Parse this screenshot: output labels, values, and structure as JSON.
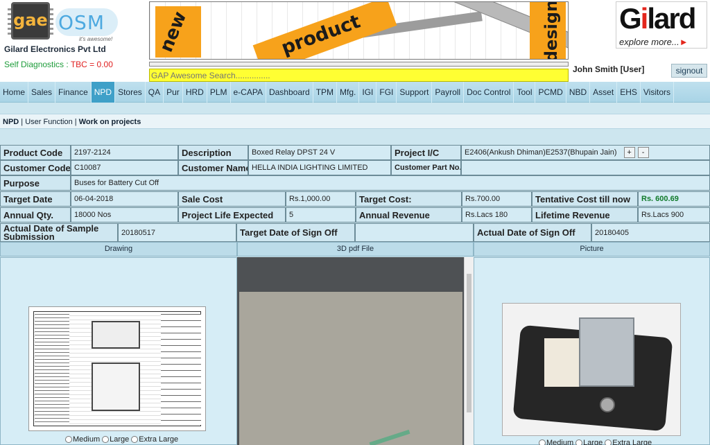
{
  "header": {
    "logo_gae": "gae",
    "logo_osm": "OSM",
    "logo_osm_tagline": "it's awesome!",
    "company": "Gilard Electronics Pvt Ltd",
    "self_diag_label": "Self Diagnostics :",
    "self_diag_value": "TBC = 0.00",
    "banner": {
      "w1": "new",
      "w2": "product",
      "w3": "design"
    },
    "search_placeholder": "GAP Awesome Search...............",
    "brand_logo": "Gilard",
    "brand_tagline": "explore more...",
    "user": "John Smith [User]",
    "signout": "signout"
  },
  "nav": [
    "Home",
    "Sales",
    "Finance",
    "NPD",
    "Stores",
    "QA",
    "Pur",
    "HRD",
    "PLM",
    "e-CAPA",
    "Dashboard",
    "TPM",
    "Mfg.",
    "IGI",
    "FGI",
    "Support",
    "Payroll",
    "Doc Control",
    "Tool",
    "PCMD",
    "NBD",
    "Asset",
    "EHS",
    "Visitors"
  ],
  "nav_active": "NPD",
  "breadcrumb": {
    "a": "NPD",
    "b": "User Function",
    "c": "Work on projects"
  },
  "details": {
    "product_code_label": "Product Code",
    "product_code": "2197-2124",
    "description_label": "Description",
    "description": "Boxed Relay DPST 24 V",
    "project_ic_label": "Project I/C",
    "project_ic": "E2406(Ankush Dhiman)E2537(Bhupain Jain)",
    "plus": "+",
    "minus": "-",
    "customer_code_label": "Customer Code",
    "customer_code": "C10087",
    "customer_name_label": "Customer Name",
    "customer_name": "HELLA INDIA LIGHTING LIMITED",
    "customer_part_label": "Customer Part No.",
    "customer_part": "",
    "purpose_label": "Purpose",
    "purpose": "Buses for Battery Cut Off",
    "target_date_label": "Target Date",
    "target_date": "06-04-2018",
    "sale_cost_label": "Sale Cost",
    "sale_cost": "Rs.1,000.00",
    "target_cost_label": "Target Cost:",
    "target_cost": "Rs.700.00",
    "tentative_cost_label": "Tentative Cost till now",
    "tentative_cost": "Rs. 600.69",
    "annual_qty_label": "Annual Qty.",
    "annual_qty": "18000 Nos",
    "project_life_label": "Project Life Expected",
    "project_life": "5",
    "annual_revenue_label": "Annual Revenue",
    "annual_revenue": "Rs.Lacs 180",
    "lifetime_revenue_label": "Lifetime Revenue",
    "lifetime_revenue": "Rs.Lacs 900",
    "sample_sub_label": "Actual Date of Sample Submission",
    "sample_sub": "20180517",
    "target_signoff_label": "Target Date of Sign Off",
    "target_signoff": "",
    "actual_signoff_label": "Actual Date of Sign Off",
    "actual_signoff": "20180405"
  },
  "panes": {
    "drawing": "Drawing",
    "pdf": "3D pdf File",
    "picture": "Picture",
    "sizes": [
      "Medium",
      "Large",
      "Extra Large"
    ]
  }
}
